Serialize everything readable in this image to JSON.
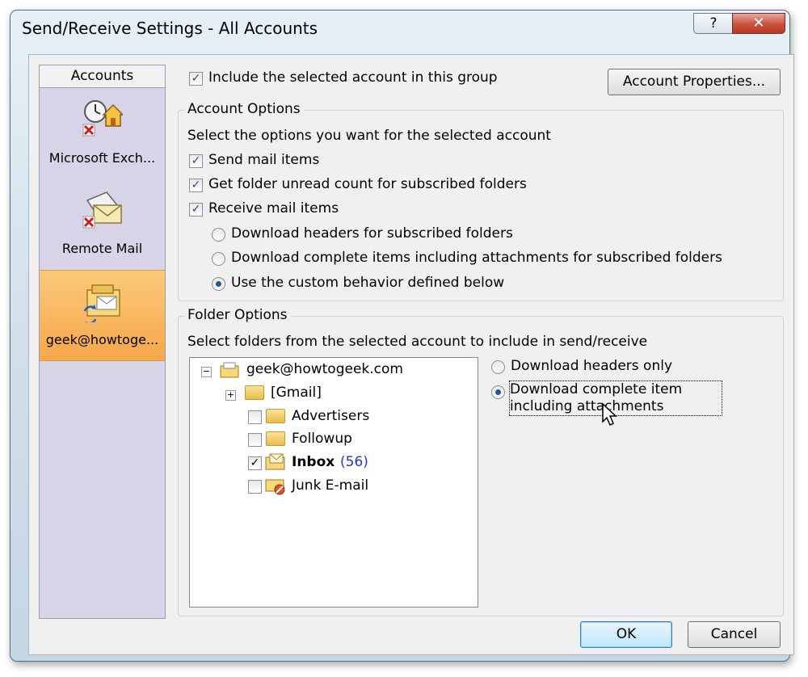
{
  "window": {
    "title": "Send/Receive Settings - All Accounts",
    "help_label": "?",
    "close_label": "✕"
  },
  "accounts": {
    "header": "Accounts",
    "items": [
      {
        "label": "Microsoft Exch...",
        "icon": "exchange-account-icon"
      },
      {
        "label": "Remote Mail",
        "icon": "remote-mail-icon"
      },
      {
        "label": "geek@howtoge...",
        "icon": "imap-account-icon",
        "selected": true
      }
    ]
  },
  "include_group": {
    "label": "Include the selected account in this group",
    "checked": true
  },
  "account_properties_button": "Account Properties...",
  "account_options": {
    "title": "Account Options",
    "description": "Select the options you want for the selected account",
    "checks": [
      {
        "label": "Send mail items",
        "checked": true
      },
      {
        "label": "Get folder unread count for subscribed folders",
        "checked": true
      },
      {
        "label": "Receive mail items",
        "checked": true
      }
    ],
    "radios": [
      {
        "label": "Download headers for subscribed folders",
        "selected": false
      },
      {
        "label": "Download complete items including attachments for subscribed folders",
        "selected": false
      },
      {
        "label": "Use the custom behavior defined below",
        "selected": true
      }
    ]
  },
  "folder_options": {
    "title": "Folder Options",
    "description": "Select folders from the selected account to include in send/receive",
    "tree": {
      "root": "geek@howtogeek.com",
      "gmail": "[Gmail]",
      "folders": [
        {
          "name": "Advertisers",
          "checked": false,
          "count": ""
        },
        {
          "name": "Followup",
          "checked": false,
          "count": ""
        },
        {
          "name": "Inbox",
          "checked": true,
          "count": "(56)",
          "bold": true
        },
        {
          "name": "Junk E-mail",
          "checked": false,
          "count": ""
        }
      ]
    },
    "radios": [
      {
        "label": "Download headers only",
        "selected": false
      },
      {
        "label": "Download complete item including attachments",
        "selected": true
      }
    ]
  },
  "buttons": {
    "ok": "OK",
    "cancel": "Cancel"
  }
}
